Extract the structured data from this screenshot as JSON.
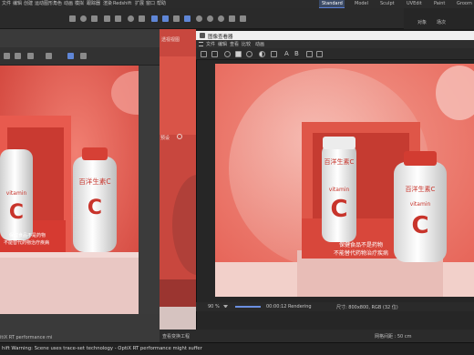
{
  "menubar": {
    "items": [
      "文件",
      "编辑",
      "创建",
      "运动图形",
      "角色",
      "动画",
      "模拟",
      "跟踪器",
      "渲染",
      "Redshift",
      "扩展",
      "窗口",
      "帮助"
    ],
    "layouts": [
      "Standard",
      "Model",
      "Sculpt",
      "UVEdit",
      "Paint",
      "Groom"
    ],
    "active_layout": "Standard"
  },
  "right_panel": {
    "tabs": [
      "对象",
      "场次"
    ]
  },
  "mid_view": {
    "label": "透视视图",
    "cam_label": "预设"
  },
  "viewer": {
    "title": "图像查看器",
    "menu": [
      "文件",
      "编辑",
      "查看",
      "比较",
      "动画"
    ],
    "tool_letters": [
      "A",
      "B"
    ],
    "zoom": "90 %",
    "progress": 1.0,
    "time": "00:00:12 Rendering",
    "size_info": "尺寸: 800x800, RGB (32 位)"
  },
  "product": {
    "brand": "百洋生素C",
    "label_word": "vitamin",
    "big_letter": "C",
    "slogan_line1": "保健食品不是药物",
    "slogan_line2": "不能替代药物治疗疾病"
  },
  "mid_status": {
    "left": "查看变换",
    "left2": "工程",
    "right": "网格间距 : 50 cm"
  },
  "status": {
    "warning": "hift Warning: Scene uses trace-set technology - OptiX RT performance might suffer"
  },
  "left_status": {
    "text": "itiX RT performance mi"
  }
}
